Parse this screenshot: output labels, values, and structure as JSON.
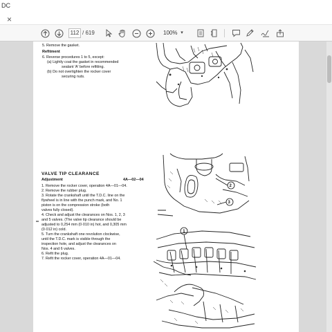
{
  "window": {
    "title": "DC"
  },
  "menubar": {
    "close_glyph": "×"
  },
  "toolbar": {
    "page_current": "112",
    "page_total": "/ 619",
    "zoom": "100%",
    "icons": [
      "up-arrow-icon",
      "down-arrow-icon",
      "hand-tool-icon",
      "zoom-out-icon",
      "zoom-in-icon",
      "fit-page-icon",
      "comment-icon",
      "pen-icon",
      "sign-icon",
      "share-icon"
    ]
  },
  "document": {
    "top_section": {
      "item5": "5.   Remove the gasket.",
      "refitment_heading": "Refitment",
      "item6": "6.   Reverse procedures 1 to 5, except:",
      "item6a_1": "(a)    Lightly coat the gasket in recommended",
      "item6a_2": "sealant 'A' before refitting.",
      "item6b_1": "(b)    Do not overtighten the rocker cover",
      "item6b_2": "securing nuts."
    },
    "valve_section": {
      "heading": "VALVE TIP CLEARANCE",
      "adjustment": "Adjustment",
      "code": "4A—02—04",
      "margin_marker": "**",
      "lines": [
        "1.   Remove the rocker cover, operation 4A—01—04.",
        "2.   Remove the rubber plug.",
        "3.   Rotate the crankshaft until the T.D.C. line on the",
        "      flywheel is in line with the punch mark, and No. 1",
        "      piston is on the compression stroke (both",
        "      valves fully closed).",
        "4.   Check and adjust the clearances on Nos. 1, 2, 3",
        "      and 5 valves. (The valve tip clearance should be",
        "      adjusted to 0,254 mm (0·010 in) hot, and 0,305 mm",
        "      (0·012 in) cold.",
        "5.   Turn the crankshaft one revolution clockwise,",
        "      until the T.D.C. mark is visible through the",
        "      inspection hole, and adjust the clearances on",
        "      Nos. 4 and 6 valves.",
        "6.   Refit the plug.",
        "7.   Refit the rocker cover, operation 4A—01—04."
      ]
    },
    "figure_labels": {
      "label_2": "2",
      "label_3": "3",
      "label_1": "1"
    }
  }
}
